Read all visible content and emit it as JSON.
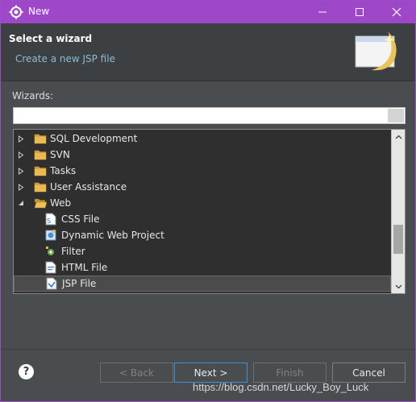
{
  "window": {
    "title": "New",
    "title_bar_color": "#9e47c9"
  },
  "header": {
    "title": "Select a wizard",
    "description": "Create a new JSP file"
  },
  "wizards_label": "Wizards:",
  "filter": {
    "value": "",
    "placeholder": ""
  },
  "tree": {
    "items": [
      {
        "label": "SQL Development",
        "type": "folder",
        "expanded": false,
        "selected": false,
        "icon": "folder-icon"
      },
      {
        "label": "SVN",
        "type": "folder",
        "expanded": false,
        "selected": false,
        "icon": "folder-icon"
      },
      {
        "label": "Tasks",
        "type": "folder",
        "expanded": false,
        "selected": false,
        "icon": "folder-icon"
      },
      {
        "label": "User Assistance",
        "type": "folder",
        "expanded": false,
        "selected": false,
        "icon": "folder-icon"
      },
      {
        "label": "Web",
        "type": "folder",
        "expanded": true,
        "selected": false,
        "icon": "folder-open-icon"
      },
      {
        "label": "CSS File",
        "type": "file",
        "selected": false,
        "icon": "css-file-icon"
      },
      {
        "label": "Dynamic Web Project",
        "type": "file",
        "selected": false,
        "icon": "web-project-icon"
      },
      {
        "label": "Filter",
        "type": "file",
        "selected": false,
        "icon": "filter-icon"
      },
      {
        "label": "HTML File",
        "type": "file",
        "selected": false,
        "icon": "html-file-icon"
      },
      {
        "label": "JSP File",
        "type": "file",
        "selected": true,
        "icon": "jsp-file-icon"
      }
    ]
  },
  "buttons": {
    "help": "?",
    "back": "< Back",
    "next": "Next >",
    "finish": "Finish",
    "cancel": "Cancel"
  },
  "watermark": "https://blog.csdn.net/Lucky_Boy_Luck"
}
